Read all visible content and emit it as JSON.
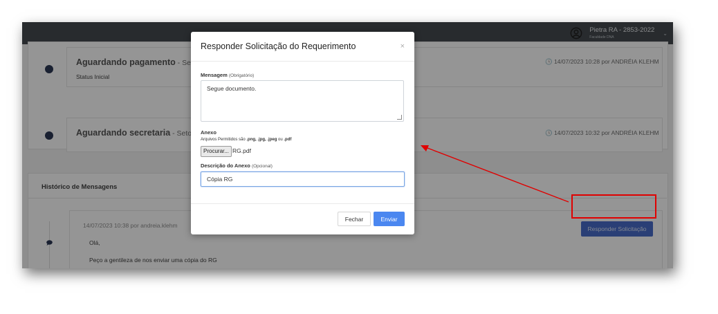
{
  "header": {
    "user_name": "Pietra RA - 2853-2022",
    "user_org": "Faculdade DNA",
    "user_icon": "user-circle-icon",
    "caret_icon": "chevron-down-icon"
  },
  "timeline": [
    {
      "title": "Aguardando pagamento",
      "sector": " - Setor:",
      "status": "Status Inicial",
      "time": "🕓 14/07/2023 10:28 por ANDRÉIA KLEHM"
    },
    {
      "title": "Aguardando secretaria",
      "sector": " - Setor: S",
      "status": "",
      "time": "🕓 14/07/2023 10:32 por ANDRÉIA KLEHM"
    }
  ],
  "messages": {
    "section_title": "Histórico de Mensagens",
    "meta": "14/07/2023 10:38 por andreia.klehm",
    "line1": "Olá,",
    "line2": "Peço a gentileza de nos enviar uma cópia do RG",
    "bubble_icon": "chat-bubble-icon"
  },
  "respond_button": "Responder Solicitação",
  "modal": {
    "title": "Responder Solicitação do Requerimento",
    "close": "×",
    "message_label": "Mensagem",
    "message_hint": "(Obrigatório)",
    "message_value": "Segue documento.",
    "attachment_label": "Anexo",
    "allowed_prefix": "Arquivos Permitidos são ",
    "allowed_types": ".png, .jpg, .jpeg",
    "allowed_or": " ou ",
    "allowed_last": ".pdf",
    "browse_label": "Procurar...",
    "file_name": "RG.pdf",
    "desc_label": "Descrição do Anexo",
    "desc_hint": "(Opcional)",
    "desc_value": "Cópia RG",
    "close_button": "Fechar",
    "send_button": "Enviar"
  },
  "colors": {
    "topbar": "#3a3f44",
    "primary": "#4b87f0",
    "annotation": "#e00000"
  }
}
